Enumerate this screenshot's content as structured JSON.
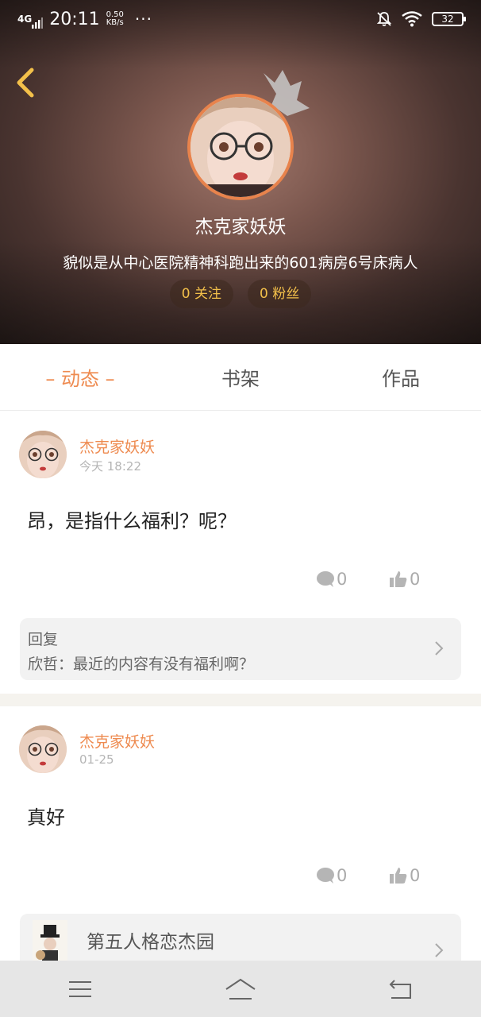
{
  "status_bar": {
    "network": "4G",
    "time": "20:11",
    "speed_value": "0.50",
    "speed_unit": "KB/s",
    "more": "···",
    "battery": "32"
  },
  "profile": {
    "name": "杰克家妖妖",
    "bio": "貌似是从中心医院精神科跑出来的601病房6号床病人",
    "following": "0 关注",
    "followers": "0 粉丝"
  },
  "tabs": [
    {
      "label": "– 动态 –",
      "active": true
    },
    {
      "label": "书架",
      "active": false
    },
    {
      "label": "作品",
      "active": false
    }
  ],
  "posts": [
    {
      "author": "杰克家妖妖",
      "time": "今天 18:22",
      "text": "昂，是指什么福利？呢？",
      "comments": "0",
      "likes": "0",
      "reply": {
        "label": "回复",
        "text": "欣哲：最近的内容有没有福利啊？"
      }
    },
    {
      "author": "杰克家妖妖",
      "time": "01-25",
      "text": "真好",
      "comments": "0",
      "likes": "0",
      "book": {
        "title": "第五人格恋杰园"
      }
    }
  ],
  "colors": {
    "accent": "#ee8a4f",
    "stat_text": "#f3c04a",
    "avatar_border": "#e8834c"
  },
  "icons": {
    "back": "chevron-left-icon",
    "crown": "crown-icon",
    "comment": "comment-bubble-icon",
    "like": "thumbs-up-icon",
    "nav_menu": "menu-icon",
    "nav_home": "home-icon",
    "nav_back": "return-icon"
  }
}
